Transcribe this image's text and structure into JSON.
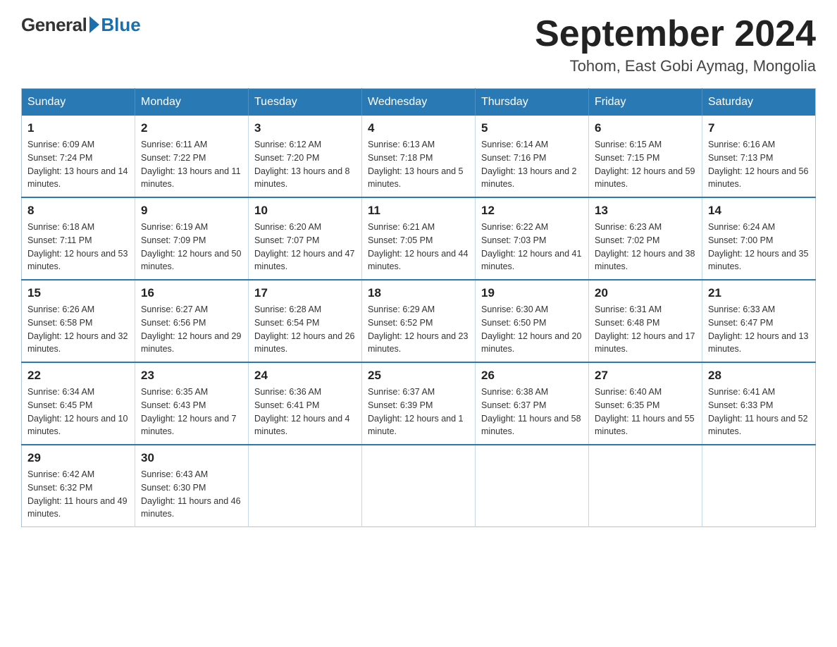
{
  "header": {
    "logo_general": "General",
    "logo_blue": "Blue",
    "month_title": "September 2024",
    "location": "Tohom, East Gobi Aymag, Mongolia"
  },
  "days_of_week": [
    "Sunday",
    "Monday",
    "Tuesday",
    "Wednesday",
    "Thursday",
    "Friday",
    "Saturday"
  ],
  "weeks": [
    [
      {
        "day": "1",
        "sunrise": "Sunrise: 6:09 AM",
        "sunset": "Sunset: 7:24 PM",
        "daylight": "Daylight: 13 hours and 14 minutes."
      },
      {
        "day": "2",
        "sunrise": "Sunrise: 6:11 AM",
        "sunset": "Sunset: 7:22 PM",
        "daylight": "Daylight: 13 hours and 11 minutes."
      },
      {
        "day": "3",
        "sunrise": "Sunrise: 6:12 AM",
        "sunset": "Sunset: 7:20 PM",
        "daylight": "Daylight: 13 hours and 8 minutes."
      },
      {
        "day": "4",
        "sunrise": "Sunrise: 6:13 AM",
        "sunset": "Sunset: 7:18 PM",
        "daylight": "Daylight: 13 hours and 5 minutes."
      },
      {
        "day": "5",
        "sunrise": "Sunrise: 6:14 AM",
        "sunset": "Sunset: 7:16 PM",
        "daylight": "Daylight: 13 hours and 2 minutes."
      },
      {
        "day": "6",
        "sunrise": "Sunrise: 6:15 AM",
        "sunset": "Sunset: 7:15 PM",
        "daylight": "Daylight: 12 hours and 59 minutes."
      },
      {
        "day": "7",
        "sunrise": "Sunrise: 6:16 AM",
        "sunset": "Sunset: 7:13 PM",
        "daylight": "Daylight: 12 hours and 56 minutes."
      }
    ],
    [
      {
        "day": "8",
        "sunrise": "Sunrise: 6:18 AM",
        "sunset": "Sunset: 7:11 PM",
        "daylight": "Daylight: 12 hours and 53 minutes."
      },
      {
        "day": "9",
        "sunrise": "Sunrise: 6:19 AM",
        "sunset": "Sunset: 7:09 PM",
        "daylight": "Daylight: 12 hours and 50 minutes."
      },
      {
        "day": "10",
        "sunrise": "Sunrise: 6:20 AM",
        "sunset": "Sunset: 7:07 PM",
        "daylight": "Daylight: 12 hours and 47 minutes."
      },
      {
        "day": "11",
        "sunrise": "Sunrise: 6:21 AM",
        "sunset": "Sunset: 7:05 PM",
        "daylight": "Daylight: 12 hours and 44 minutes."
      },
      {
        "day": "12",
        "sunrise": "Sunrise: 6:22 AM",
        "sunset": "Sunset: 7:03 PM",
        "daylight": "Daylight: 12 hours and 41 minutes."
      },
      {
        "day": "13",
        "sunrise": "Sunrise: 6:23 AM",
        "sunset": "Sunset: 7:02 PM",
        "daylight": "Daylight: 12 hours and 38 minutes."
      },
      {
        "day": "14",
        "sunrise": "Sunrise: 6:24 AM",
        "sunset": "Sunset: 7:00 PM",
        "daylight": "Daylight: 12 hours and 35 minutes."
      }
    ],
    [
      {
        "day": "15",
        "sunrise": "Sunrise: 6:26 AM",
        "sunset": "Sunset: 6:58 PM",
        "daylight": "Daylight: 12 hours and 32 minutes."
      },
      {
        "day": "16",
        "sunrise": "Sunrise: 6:27 AM",
        "sunset": "Sunset: 6:56 PM",
        "daylight": "Daylight: 12 hours and 29 minutes."
      },
      {
        "day": "17",
        "sunrise": "Sunrise: 6:28 AM",
        "sunset": "Sunset: 6:54 PM",
        "daylight": "Daylight: 12 hours and 26 minutes."
      },
      {
        "day": "18",
        "sunrise": "Sunrise: 6:29 AM",
        "sunset": "Sunset: 6:52 PM",
        "daylight": "Daylight: 12 hours and 23 minutes."
      },
      {
        "day": "19",
        "sunrise": "Sunrise: 6:30 AM",
        "sunset": "Sunset: 6:50 PM",
        "daylight": "Daylight: 12 hours and 20 minutes."
      },
      {
        "day": "20",
        "sunrise": "Sunrise: 6:31 AM",
        "sunset": "Sunset: 6:48 PM",
        "daylight": "Daylight: 12 hours and 17 minutes."
      },
      {
        "day": "21",
        "sunrise": "Sunrise: 6:33 AM",
        "sunset": "Sunset: 6:47 PM",
        "daylight": "Daylight: 12 hours and 13 minutes."
      }
    ],
    [
      {
        "day": "22",
        "sunrise": "Sunrise: 6:34 AM",
        "sunset": "Sunset: 6:45 PM",
        "daylight": "Daylight: 12 hours and 10 minutes."
      },
      {
        "day": "23",
        "sunrise": "Sunrise: 6:35 AM",
        "sunset": "Sunset: 6:43 PM",
        "daylight": "Daylight: 12 hours and 7 minutes."
      },
      {
        "day": "24",
        "sunrise": "Sunrise: 6:36 AM",
        "sunset": "Sunset: 6:41 PM",
        "daylight": "Daylight: 12 hours and 4 minutes."
      },
      {
        "day": "25",
        "sunrise": "Sunrise: 6:37 AM",
        "sunset": "Sunset: 6:39 PM",
        "daylight": "Daylight: 12 hours and 1 minute."
      },
      {
        "day": "26",
        "sunrise": "Sunrise: 6:38 AM",
        "sunset": "Sunset: 6:37 PM",
        "daylight": "Daylight: 11 hours and 58 minutes."
      },
      {
        "day": "27",
        "sunrise": "Sunrise: 6:40 AM",
        "sunset": "Sunset: 6:35 PM",
        "daylight": "Daylight: 11 hours and 55 minutes."
      },
      {
        "day": "28",
        "sunrise": "Sunrise: 6:41 AM",
        "sunset": "Sunset: 6:33 PM",
        "daylight": "Daylight: 11 hours and 52 minutes."
      }
    ],
    [
      {
        "day": "29",
        "sunrise": "Sunrise: 6:42 AM",
        "sunset": "Sunset: 6:32 PM",
        "daylight": "Daylight: 11 hours and 49 minutes."
      },
      {
        "day": "30",
        "sunrise": "Sunrise: 6:43 AM",
        "sunset": "Sunset: 6:30 PM",
        "daylight": "Daylight: 11 hours and 46 minutes."
      },
      null,
      null,
      null,
      null,
      null
    ]
  ]
}
